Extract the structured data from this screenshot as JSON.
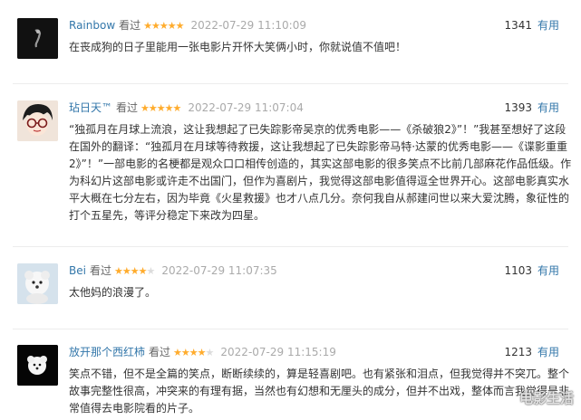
{
  "reviews": [
    {
      "user": "Rainbow",
      "watched": "看过",
      "stars": 5,
      "time": "2022-07-29 11:10:09",
      "votes": "1341",
      "useful": "有用",
      "content": "在丧成狗的日子里能用一张电影片开怀大笑俩小时，你就说值不值吧！"
    },
    {
      "user": "玷日天™",
      "watched": "看过",
      "stars": 5,
      "time": "2022-07-29 11:07:04",
      "votes": "1393",
      "useful": "有用",
      "content": "“独孤月在月球上流浪，这让我想起了已失踪影帝吴京的优秀电影——《杀破狼2》”！”我甚至想好了这段在国外的翻译：“独孤月在月球等待救援，这让我想起了已失踪影帝马特·达蒙的优秀电影——《谍影重重2》”！”一部电影的名梗都是观众口口相传创造的，其实这部电影的很多笑点不比前几部麻花作品低级。作为科幻片这部电影或许走不出国门，但作为喜剧片，我觉得这部电影值得逗全世界开心。这部电影真实水平大概在七分左右，因为毕竟《火星救援》也才八点几分。奈何我自从郝建问世以来大爱沈腾，象征性的打个五星先，等评分稳定下来改为四星。"
    },
    {
      "user": "Bei",
      "watched": "看过",
      "stars": 4,
      "time": "2022-07-29 11:07:35",
      "votes": "1103",
      "useful": "有用",
      "content": "太他妈的浪漫了。"
    },
    {
      "user": "放开那个西红柿",
      "watched": "看过",
      "stars": 4,
      "time": "2022-07-29 11:15:19",
      "votes": "1213",
      "useful": "有用",
      "content": "笑点不错，但不是全篇的笑点，断断续续的，算是轻喜剧吧。也有紧张和泪点，但我觉得并不突兀。整个故事完整性很高，冲突来的有理有据，当然也有幻想和无厘头的成分，但并不出戏，整体而言我觉得是非常值得去电影院看的片子。"
    }
  ],
  "watermark": "电影生活",
  "colors": {
    "username": "#3377aa",
    "star_on": "#ffac2d",
    "star_off": "#dcdcdc",
    "timestamp": "#aaaaaa"
  }
}
